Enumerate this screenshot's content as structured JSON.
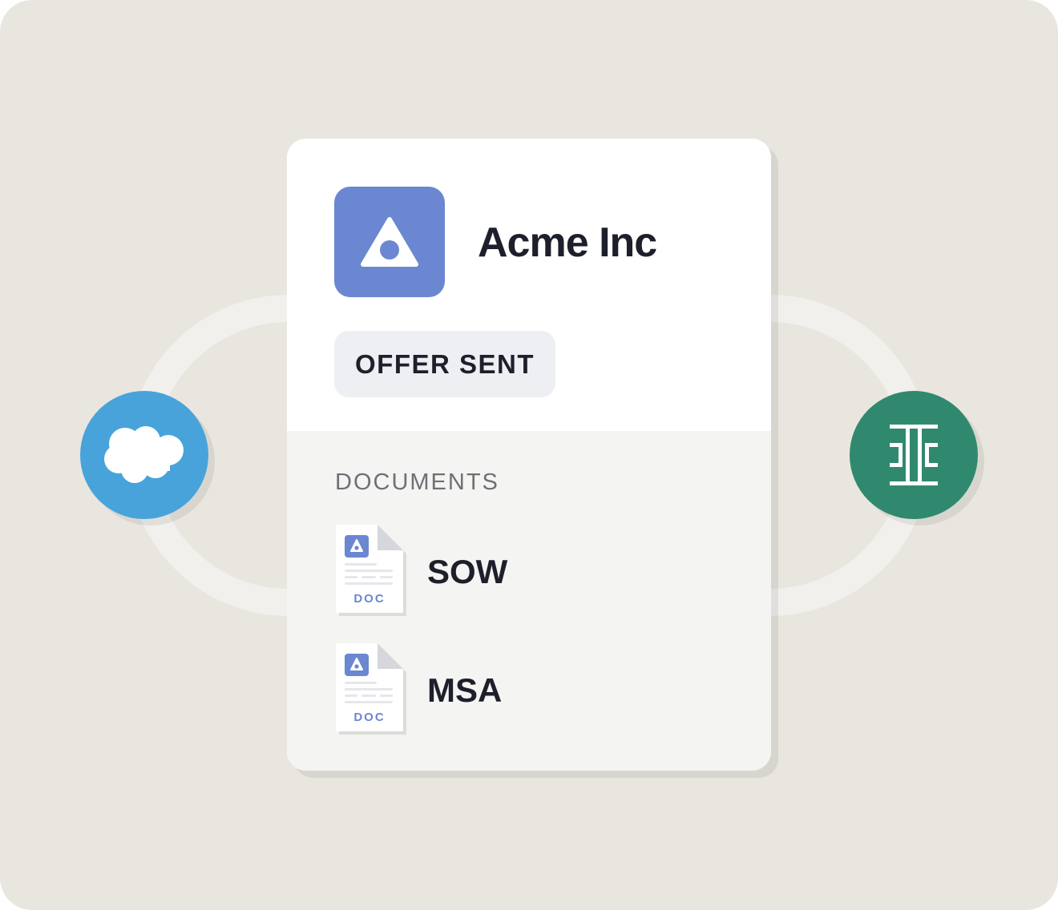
{
  "colors": {
    "page_background": "#e9e6df",
    "connector": "#f1f0ec",
    "card_top": "#ffffff",
    "card_bottom": "#f4f4f2",
    "brand": "#6b87d1",
    "salesforce_blue": "#48a3db",
    "right_app_green": "#30896f",
    "text_primary": "#1d1f2b",
    "text_muted": "#6f7076",
    "badge_background": "#eeeff2"
  },
  "integrations": {
    "left": {
      "icon": "salesforce-cloud-icon"
    },
    "right": {
      "icon": "i-beam-logo-icon"
    }
  },
  "card": {
    "company": {
      "name": "Acme Inc",
      "logo_icon": "triangle-dot-logo-icon"
    },
    "status": "OFFER SENT",
    "documents": {
      "label": "DOCUMENTS",
      "items": [
        {
          "name": "SOW",
          "type_label": "DOC",
          "icon": "document-file-icon"
        },
        {
          "name": "MSA",
          "type_label": "DOC",
          "icon": "document-file-icon"
        }
      ]
    }
  }
}
